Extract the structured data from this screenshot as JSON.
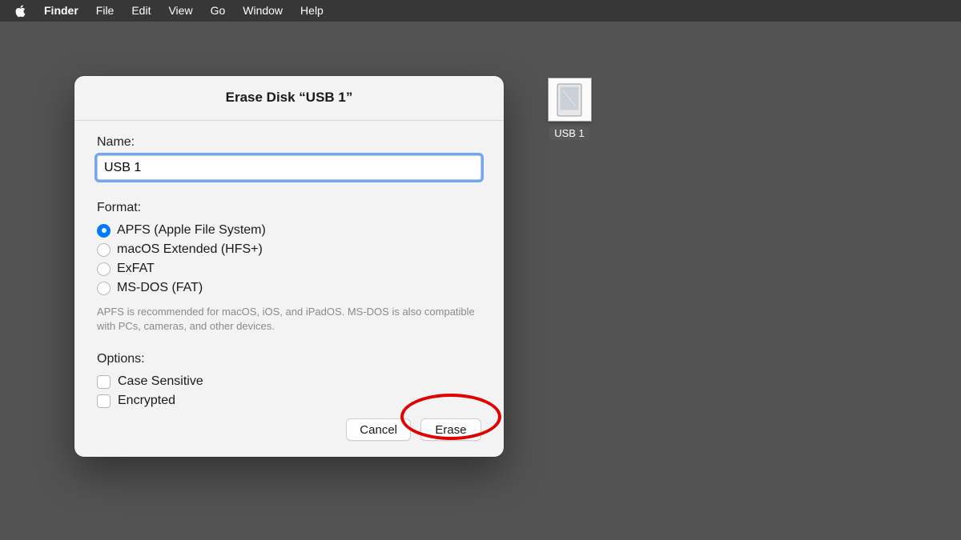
{
  "menubar": {
    "app": "Finder",
    "items": [
      "File",
      "Edit",
      "View",
      "Go",
      "Window",
      "Help"
    ]
  },
  "desktop": {
    "usb_icon_label": "USB 1"
  },
  "dialog": {
    "title": "Erase Disk “USB 1”",
    "name_label": "Name:",
    "name_value": "USB 1",
    "format_label": "Format:",
    "formats": [
      {
        "label": "APFS (Apple File System)",
        "selected": true
      },
      {
        "label": "macOS Extended (HFS+)",
        "selected": false
      },
      {
        "label": "ExFAT",
        "selected": false
      },
      {
        "label": "MS-DOS (FAT)",
        "selected": false
      }
    ],
    "format_hint": "APFS is recommended for macOS, iOS, and iPadOS. MS-DOS is also compatible with PCs, cameras, and other devices.",
    "options_label": "Options:",
    "options": [
      {
        "label": "Case Sensitive",
        "checked": false
      },
      {
        "label": "Encrypted",
        "checked": false
      }
    ],
    "cancel": "Cancel",
    "erase": "Erase"
  }
}
